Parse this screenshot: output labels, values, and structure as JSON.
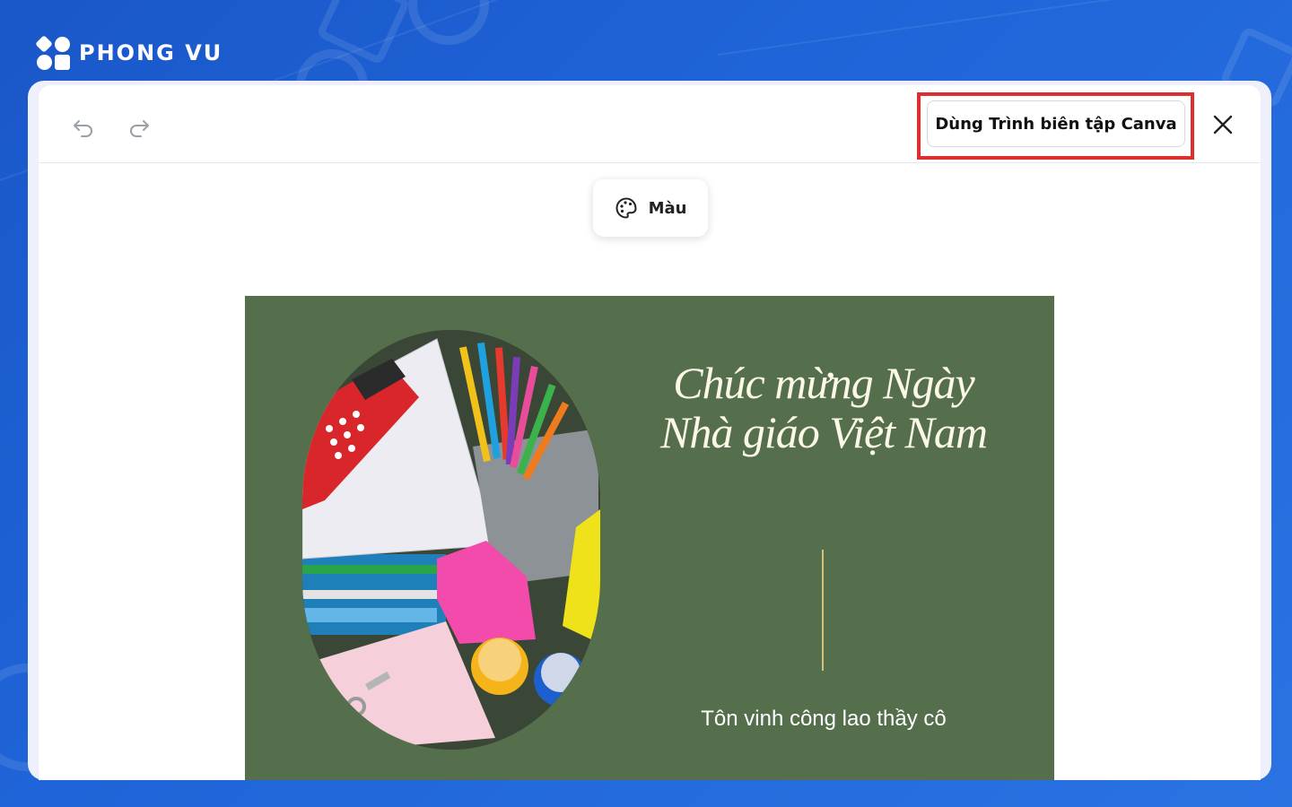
{
  "brand": {
    "name": "PHONG VU"
  },
  "toolbar": {
    "undo_icon": "undo-icon",
    "redo_icon": "redo-icon",
    "canva_button_label": "Dùng Trình biên tập Canva",
    "close_icon": "close-icon"
  },
  "color_button": {
    "label": "Màu",
    "icon": "palette-icon"
  },
  "design": {
    "title": "Chúc mừng Ngày Nhà giáo Việt Nam",
    "subtitle": "Tôn vinh công lao thầy cô",
    "photo": "school-supplies-photo"
  },
  "colors": {
    "background": "#1f64d8",
    "card": "#556f4c",
    "highlight": "#e02d2d",
    "divider": "#d4c07a"
  }
}
